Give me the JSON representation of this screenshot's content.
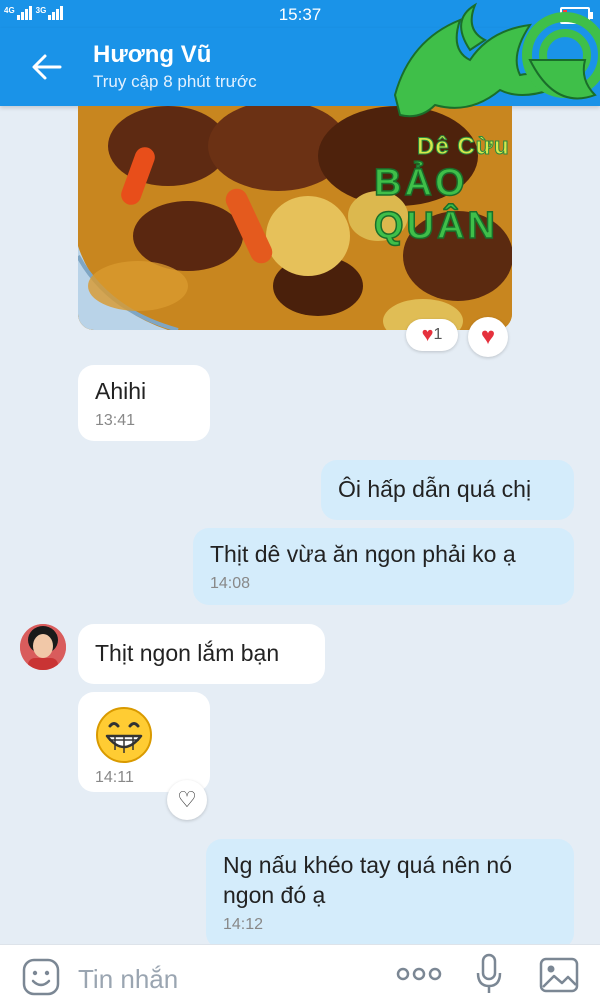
{
  "status_bar": {
    "time": "15:37",
    "network_1": "4G",
    "network_2": "3G"
  },
  "header": {
    "name": "Hương Vũ",
    "status": "Truy cập 8 phút trước"
  },
  "watermark": {
    "line1": "Dê Cừu",
    "line2": "BẢO QUÂN"
  },
  "photo_reactions": {
    "heart_count": "1"
  },
  "messages": [
    {
      "text": "Ahihi",
      "time": "13:41"
    },
    {
      "text": "Ôi hấp dẫn quá chị"
    },
    {
      "text": "Thịt dê vừa ăn ngon phải ko ạ",
      "time": "14:08"
    },
    {
      "text": "Thịt ngon lắm bạn"
    },
    {
      "text": "",
      "time": "14:11"
    },
    {
      "text": "Ng nấu khéo tay quá nên nó ngon đó ạ",
      "time": "14:12"
    }
  ],
  "input": {
    "placeholder": "Tin nhắn"
  },
  "colors": {
    "header": "#1a93e8",
    "incoming": "#ffffff",
    "outgoing": "#d4ecfb",
    "background": "#e5edf5"
  },
  "icons": [
    "back-arrow-icon",
    "sticker-icon",
    "more-icon",
    "microphone-icon",
    "image-icon",
    "heart-icon"
  ]
}
